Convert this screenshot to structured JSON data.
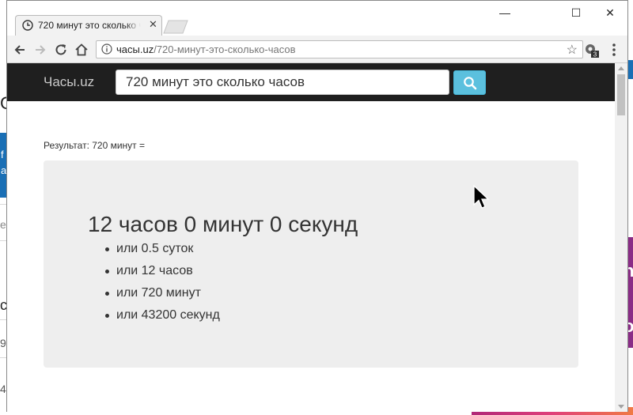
{
  "browser": {
    "tab": {
      "title": "720 минут это сколько ч"
    },
    "window_controls": {
      "minimize": "—",
      "maximize": "☐",
      "close": "✕"
    },
    "address": {
      "host": "часы.uz",
      "path": "/720-минут-это-сколько-часов"
    },
    "extension_badge": "3"
  },
  "site": {
    "brand": "Часы.uz",
    "search": {
      "value": "720 минут это сколько часов"
    }
  },
  "result": {
    "label": "Результат: 720 минут =",
    "main": "12 часов 0 минут 0 секунд",
    "items": [
      {
        "text": "или 0.5 суток"
      },
      {
        "text": "или 12 часов"
      },
      {
        "text": "или 720 минут"
      },
      {
        "text": "или 43200 секунд"
      }
    ]
  },
  "colors": {
    "header_bg": "#1f1f1f",
    "search_button": "#5bc0de",
    "panel_bg": "#eeeeee"
  },
  "background_fragments": {
    "left": [
      "С",
      "f",
      "а",
      "е",
      "с",
      "9",
      "4"
    ],
    "right": [
      "n",
      "o"
    ]
  }
}
